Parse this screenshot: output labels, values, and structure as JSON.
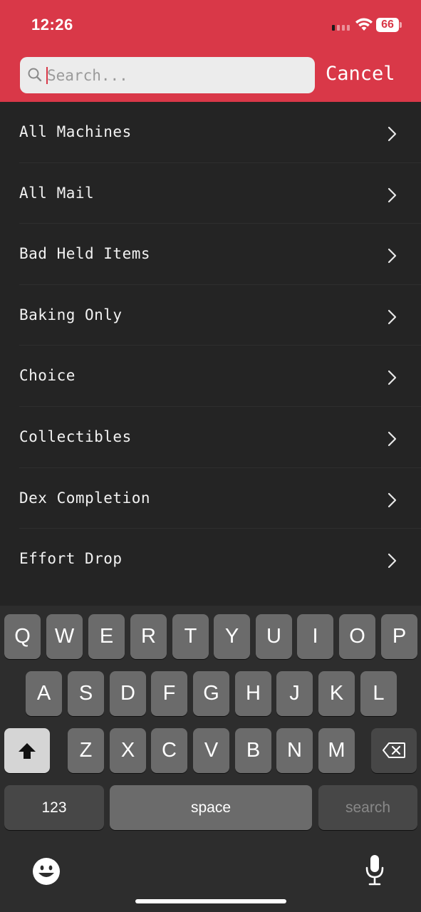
{
  "status_bar": {
    "time": "12:26",
    "battery": "66"
  },
  "search": {
    "placeholder": "Search...",
    "cancel_label": "Cancel"
  },
  "list": {
    "items": [
      {
        "label": "All Machines"
      },
      {
        "label": "All Mail"
      },
      {
        "label": "Bad Held Items"
      },
      {
        "label": "Baking Only"
      },
      {
        "label": "Choice"
      },
      {
        "label": "Collectibles"
      },
      {
        "label": "Dex Completion"
      },
      {
        "label": "Effort Drop"
      }
    ]
  },
  "keyboard": {
    "row1": [
      "Q",
      "W",
      "E",
      "R",
      "T",
      "Y",
      "U",
      "I",
      "O",
      "P"
    ],
    "row2": [
      "A",
      "S",
      "D",
      "F",
      "G",
      "H",
      "J",
      "K",
      "L"
    ],
    "row3": [
      "Z",
      "X",
      "C",
      "V",
      "B",
      "N",
      "M"
    ],
    "numbers_label": "123",
    "space_label": "space",
    "search_label": "search"
  },
  "colors": {
    "accent": "#d93848",
    "list_bg": "#242424",
    "keyboard_bg": "#2d2d2d"
  }
}
